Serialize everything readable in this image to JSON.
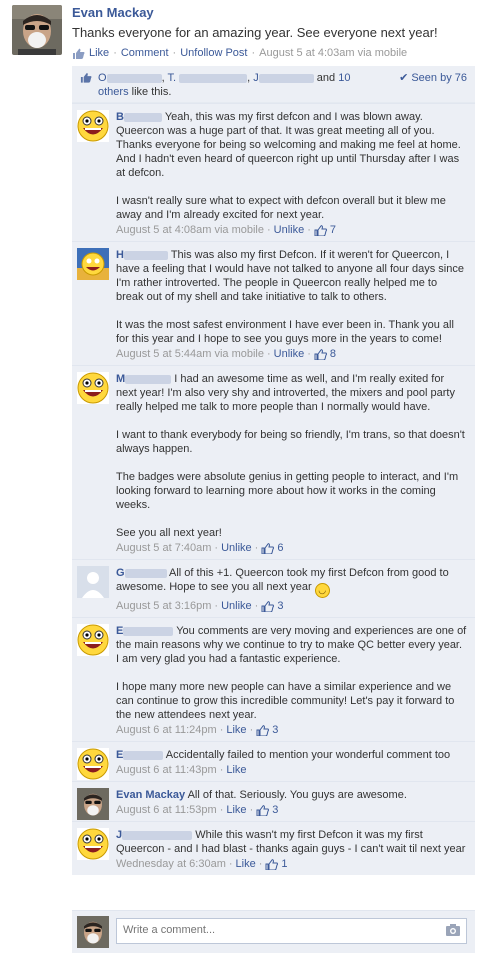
{
  "post": {
    "author": "Evan Mackay",
    "text": "Thanks everyone for an amazing year. See everyone next year!",
    "actions": {
      "like": "Like",
      "comment": "Comment",
      "unfollow": "Unfollow Post",
      "time": "August 5 at 4:03am via mobile"
    }
  },
  "likes": {
    "names": [
      "O",
      "T.",
      "J"
    ],
    "and": "and",
    "others_count": "10",
    "others_text": "others",
    "suffix": "like this.",
    "seen": "Seen by 76"
  },
  "comments": [
    {
      "name": "B",
      "paragraphs": [
        "Yeah, this was my first defcon and I was blown away. Queercon was a huge part of that. It was great meeting all of you. Thanks everyone for being so welcoming and making me feel at home. And I hadn't even heard of queercon right up until Thursday after I was at defcon.",
        "I wasn't really sure what to expect with defcon overall but it blew me away and I'm already excited for next year."
      ],
      "time": "August 5 at 4:08am via mobile",
      "action": "Unlike",
      "likes": "7"
    },
    {
      "name": "H",
      "paragraphs": [
        "This was also my first Defcon. If it weren't for Queercon, I have a feeling that I would have not talked to anyone all four days since I'm rather introverted. The people in Queercon really helped me to break out of my shell and take initiative to talk to others.",
        "It was the most safest environment I have ever been in. Thank you all for this year and I hope to see you guys more in the years to come!"
      ],
      "time": "August 5 at 5:44am via mobile",
      "action": "Unlike",
      "likes": "8"
    },
    {
      "name": "M",
      "paragraphs": [
        "I had an awesome time as well, and I'm really exited for next year! I'm also very shy and introverted, the mixers and pool party really helped me talk to more people than I normally would have.",
        "I want to thank everybody for being so friendly, I'm trans, so that doesn't always happen.",
        "The badges were absolute genius in getting people to interact, and I'm looking forward to learning more about how it works in the coming weeks.",
        "See you all next year!"
      ],
      "time": "August 5 at 7:40am",
      "action": "Unlike",
      "likes": "6"
    },
    {
      "name": "G",
      "paragraphs": [
        "All of this +1. Queercon took my first Defcon from good to awesome. Hope to see you all next year"
      ],
      "time": "August 5 at 3:16pm",
      "action": "Unlike",
      "likes": "3"
    },
    {
      "name": "E",
      "paragraphs": [
        "You comments are very moving and experiences are one of the main reasons why we continue to try to make QC better every year. I am very glad you had a fantastic experience.",
        "I hope many more new people can have a similar experience and we can continue to grow this incredible community! Let's pay it forward to the new attendees next year."
      ],
      "time": "August 6 at 11:24pm",
      "action": "Like",
      "likes": "3"
    },
    {
      "name": "E",
      "paragraphs": [
        "Accidentally failed to mention your wonderful comment too"
      ],
      "time": "August 6 at 11:43pm",
      "action": "Like",
      "likes": ""
    },
    {
      "name": "Evan Mackay",
      "paragraphs": [
        "All of that. Seriously. You guys are awesome."
      ],
      "time": "August 6 at 11:53pm",
      "action": "Like",
      "likes": "3"
    },
    {
      "name": "J",
      "paragraphs": [
        "While this wasn't my first Defcon it was my first Queercon - and I had blast - thanks again guys - I can't wait til next year"
      ],
      "time": "Wednesday at 6:30am",
      "action": "Like",
      "likes": "1"
    }
  ],
  "composer": {
    "placeholder": "Write a comment..."
  },
  "colors": {
    "link": "#3b5998",
    "panel": "#eceff5",
    "meta": "#999999"
  }
}
